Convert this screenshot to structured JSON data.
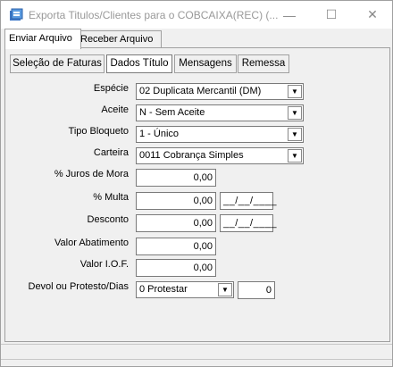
{
  "window": {
    "title": "Exporta Titulos/Clientes para o COBCAIXA(REC) (...",
    "controls": {
      "minimize": "—",
      "maximize": "☐",
      "close": "✕"
    }
  },
  "tabs": [
    "Enviar Arquivo",
    "Receber Arquivo"
  ],
  "subtabs": [
    "Seleção de Faturas",
    "Dados Título",
    "Mensagens",
    "Remessa"
  ],
  "form": {
    "especie": {
      "label": "Espécie",
      "value": "02 Duplicata Mercantil (DM)"
    },
    "aceite": {
      "label": "Aceite",
      "value": "N - Sem Aceite"
    },
    "tipo_bloqueto": {
      "label": "Tipo Bloqueto",
      "value": "1 - Único"
    },
    "carteira": {
      "label": "Carteira",
      "value": "0011 Cobrança Simples"
    },
    "juros_mora": {
      "label": "% Juros de Mora",
      "value": "0,00"
    },
    "multa": {
      "label": "% Multa",
      "value": "0,00",
      "date": "__/__/____"
    },
    "desconto": {
      "label": "Desconto",
      "value": "0,00",
      "date": "__/__/____"
    },
    "valor_abatimento": {
      "label": "Valor Abatimento",
      "value": "0,00"
    },
    "valor_iof": {
      "label": "Valor I.O.F.",
      "value": "0,00"
    },
    "devol_protesto": {
      "label": "Devol ou Protesto/Dias",
      "value": "0 Protestar",
      "dias": "0"
    }
  },
  "colors": {
    "window_bg": "#f0f0f0",
    "field_bg": "#ffffff",
    "border": "#7a7a7a"
  }
}
